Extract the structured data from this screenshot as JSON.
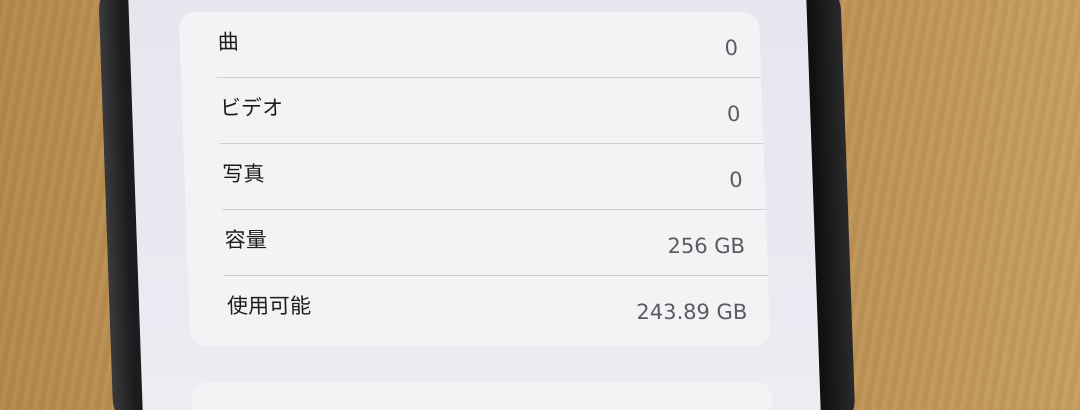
{
  "about": {
    "rows": [
      {
        "label": "曲",
        "value": "0"
      },
      {
        "label": "ビデオ",
        "value": "0"
      },
      {
        "label": "写真",
        "value": "0"
      },
      {
        "label": "容量",
        "value": "256 GB"
      },
      {
        "label": "使用可能",
        "value": "243.89 GB"
      }
    ]
  },
  "colors": {
    "screen_bg": "#e9e9f1",
    "card_bg": "#f3f3f6",
    "label_text": "#1c1c1e",
    "value_text": "#5b5b60",
    "divider": "#cfcfd4",
    "desk": "#c49a5c"
  }
}
